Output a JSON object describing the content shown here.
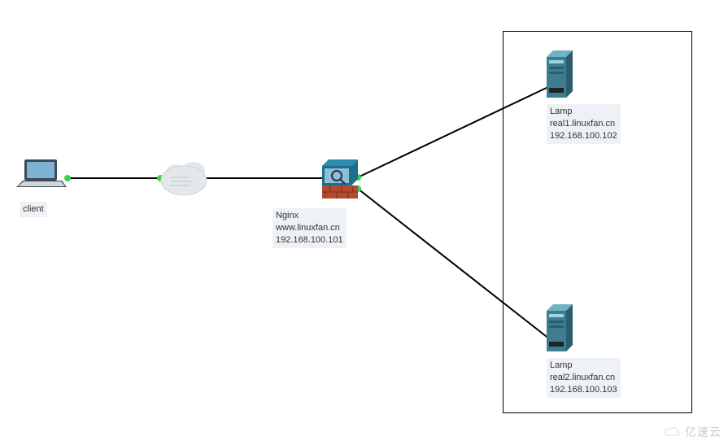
{
  "devices": {
    "client": {
      "label": "client"
    },
    "nginx": {
      "label": "Nginx",
      "hostname": "www.linuxfan.cn",
      "ip": "192.168.100.101"
    },
    "lamp1": {
      "label": "Lamp",
      "hostname": "real1.linuxfan.cn",
      "ip": "192.168.100.102"
    },
    "lamp2": {
      "label": "Lamp",
      "hostname": "real2.linuxfan.cn",
      "ip": "192.168.100.103"
    },
    "cloud": {
      "label": ""
    }
  },
  "watermark": "亿速云",
  "chart_data": {
    "type": "network-diagram",
    "nodes": [
      {
        "id": "client",
        "type": "laptop",
        "label": "client"
      },
      {
        "id": "cloud",
        "type": "cloud"
      },
      {
        "id": "nginx",
        "type": "firewall",
        "label": "Nginx",
        "hostname": "www.linuxfan.cn",
        "ip": "192.168.100.101"
      },
      {
        "id": "lamp1",
        "type": "server",
        "label": "Lamp",
        "hostname": "real1.linuxfan.cn",
        "ip": "192.168.100.102"
      },
      {
        "id": "lamp2",
        "type": "server",
        "label": "Lamp",
        "hostname": "real2.linuxfan.cn",
        "ip": "192.168.100.103"
      }
    ],
    "edges": [
      {
        "from": "client",
        "to": "cloud"
      },
      {
        "from": "cloud",
        "to": "nginx"
      },
      {
        "from": "nginx",
        "to": "lamp1"
      },
      {
        "from": "nginx",
        "to": "lamp2"
      }
    ],
    "groups": [
      {
        "name": "backend-servers",
        "members": [
          "lamp1",
          "lamp2"
        ]
      }
    ]
  }
}
